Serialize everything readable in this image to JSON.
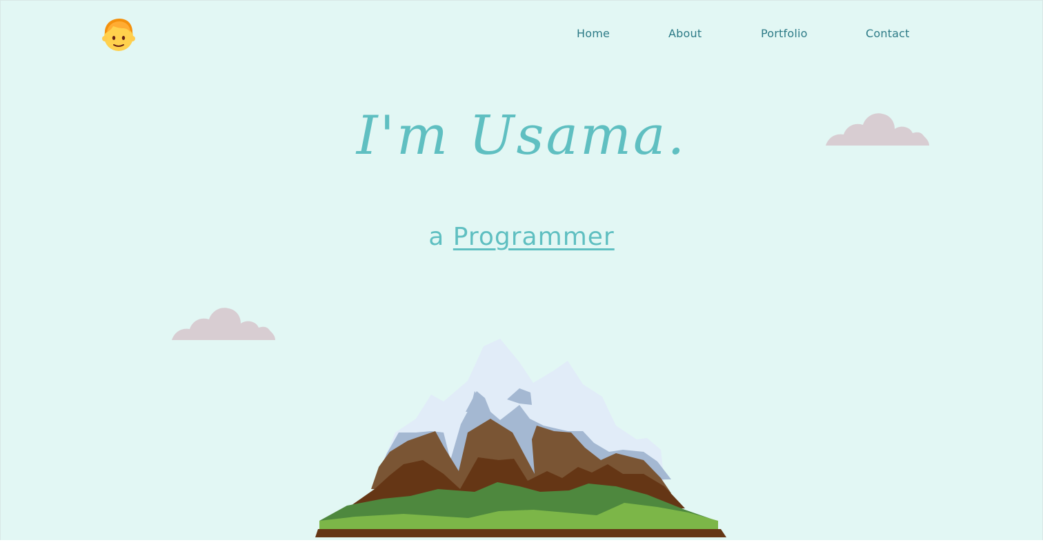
{
  "header": {
    "logo_icon": "boy-face-emoji-icon",
    "nav": {
      "home": "Home",
      "about": "About",
      "portfolio": "Portfolio",
      "contact": "Contact"
    }
  },
  "hero": {
    "title": "I'm Usama.",
    "subtitle_prefix": "a",
    "subtitle_role": "Programmer"
  },
  "decorations": {
    "clouds": [
      "cloud-icon",
      "cloud-icon"
    ],
    "illustration": "snowy-mountain-illustration"
  },
  "colors": {
    "background": "#e2f7f4",
    "accent": "#5fbfc1",
    "nav_text": "#2c7a86",
    "cloud": "#d8cdd2"
  }
}
